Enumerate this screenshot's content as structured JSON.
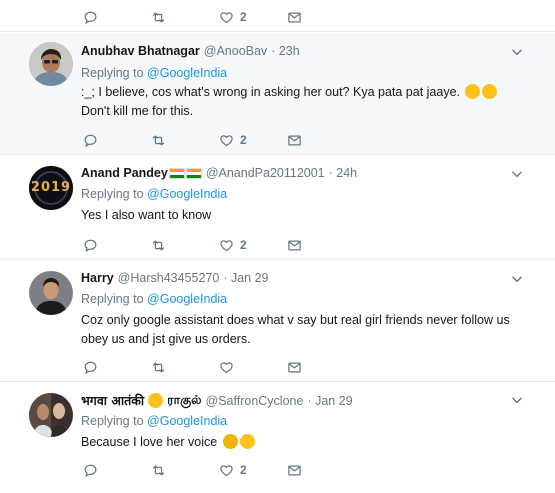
{
  "top_actions": {
    "like_count": "2"
  },
  "tweets": [
    {
      "name": "Anubhav Bhatnagar",
      "handle": "@AnooBav",
      "time": "· 23h",
      "replying_label": "Replying to",
      "replying_to": "@GoogleIndia",
      "text_line1": ":_; I believe, cos what's wrong in asking her out? Kya pata pat jaaye.",
      "text_line2": "Don't kill me for this.",
      "like_count": "2",
      "emoji": [
        "laughing-tears-emoji",
        "laughing-tears-emoji"
      ]
    },
    {
      "name": "Anand Pandey",
      "handle": "@AnandPa20112001",
      "time": "· 24h",
      "replying_label": "Replying to",
      "replying_to": "@GoogleIndia",
      "text_line1": "Yes I also want to know",
      "like_count": "2",
      "avatar_text": "2019",
      "emoji": [
        "india-flag-emoji",
        "india-flag-emoji"
      ]
    },
    {
      "name": "Harry",
      "handle": "@Harsh43455270",
      "time": "· Jan 29",
      "replying_label": "Replying to",
      "replying_to": "@GoogleIndia",
      "text_line1": "Coz only google assistant does what v say but real girl friends never follow us",
      "text_line2": "obey us and jst give us orders.",
      "like_count": ""
    },
    {
      "name_part1": "भगवा आतंकी",
      "name_part2": "ராகுல்",
      "handle": "@SaffronCyclone",
      "time": "· Jan 29",
      "replying_label": "Replying to",
      "replying_to": "@GoogleIndia",
      "text_line1": "Because I love her voice",
      "like_count": "2",
      "emoji": [
        "sunglasses-emoji",
        "confused-emoji",
        "laughing-tears-emoji"
      ]
    }
  ],
  "colors": {
    "link": "#1b95e0",
    "secondary": "#657786",
    "highlight_bg": "#f5f8fa",
    "divider": "#e6ecf0"
  }
}
